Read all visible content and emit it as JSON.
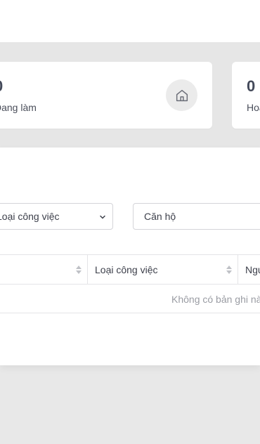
{
  "stats": [
    {
      "number": "0",
      "label": "Đang làm",
      "icon": "home-icon"
    },
    {
      "number": "0",
      "label": "Hoàn thành"
    }
  ],
  "filters": {
    "job_type_value": "Loại công việc",
    "apartment_value": "Căn hộ"
  },
  "table": {
    "columns": [
      "",
      "Loại công việc",
      "Người"
    ],
    "empty_text": "Không có bản ghi nào"
  },
  "colors": {
    "page_bg": "#e8e8e8",
    "card_bg": "#ffffff",
    "icon_circle": "#ebebeb"
  }
}
